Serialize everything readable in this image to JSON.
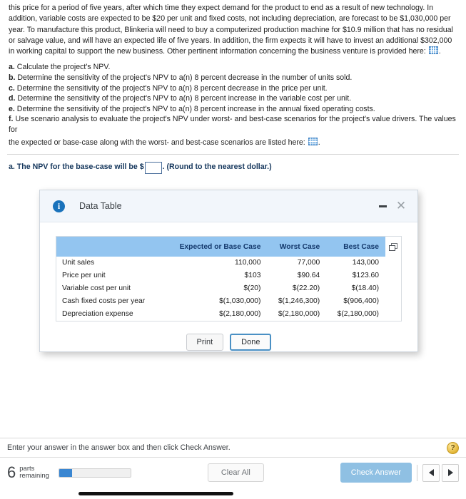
{
  "question": {
    "intro": "this price for a period of five years, after which time they expect demand for the product to end as a result of new technology.  In addition, variable costs are expected to be $20 per unit and fixed costs, not including depreciation, are forecast to be $1,030,000 per year.  To manufacture this product, Blinkeria will need to buy a computerized production machine for $10.9 million that has no residual or salvage value, and will have an expected life of five years.  In addition, the firm expects it will have to invest an additional $302,000 in working capital to support the new business.  Other pertinent information concerning the business venture is provided here:",
    "intro_icon": "grid-table-icon",
    "intro_trailing": ".",
    "parts": [
      {
        "letter": "a.",
        "text": "Calculate the project's NPV."
      },
      {
        "letter": "b.",
        "text": "Determine the sensitivity of the project's NPV to a(n) 8 percent decrease in the number of units sold."
      },
      {
        "letter": "c.",
        "text": "Determine the sensitivity of the project's NPV to a(n) 8 percent decrease in the price per unit."
      },
      {
        "letter": "d.",
        "text": "Determine the sensitivity of the project's NPV to a(n) 8 percent increase in the variable cost per unit."
      },
      {
        "letter": "e.",
        "text": "Determine the sensitivity of the project's NPV to a(n) 8 percent increase in the annual fixed operating costs."
      },
      {
        "letter": "f.",
        "text": "Use scenario analysis to evaluate the project's NPV under worst- and best-case scenarios for the project's value drivers.  The values for"
      }
    ],
    "part_f_tail": "the expected or base-case along with the worst- and best-case scenarios are listed here:",
    "part_f_icon": "grid-table-icon",
    "part_f_trailing": "."
  },
  "answer": {
    "letter": "a.",
    "prompt_before": "The NPV for the base-case will be $",
    "input_value": "",
    "prompt_after": ".  (Round to the nearest dollar.)"
  },
  "dialog": {
    "title": "Data Table",
    "info_icon": "info-circle-icon",
    "minimize_icon": "minimize-icon",
    "close_icon": "close-icon",
    "copy_icon": "copy-icon",
    "print_label": "Print",
    "done_label": "Done",
    "header_bg": "#f2f6fb",
    "table_header_bg": "#93c5f0"
  },
  "chart_data": {
    "type": "table",
    "title": "Data Table",
    "columns": [
      "",
      "Expected or Base Case",
      "Worst Case",
      "Best Case"
    ],
    "rows": [
      {
        "label": "Unit sales",
        "values": [
          "110,000",
          "77,000",
          "143,000"
        ]
      },
      {
        "label": "Price per unit",
        "values": [
          "$103",
          "$90.64",
          "$123.60"
        ]
      },
      {
        "label": "Variable cost per unit",
        "values": [
          "$(20)",
          "$(22.20)",
          "$(18.40)"
        ]
      },
      {
        "label": "Cash fixed costs per year",
        "values": [
          "$(1,030,000)",
          "$(1,246,300)",
          "$(906,400)"
        ]
      },
      {
        "label": "Depreciation expense",
        "values": [
          "$(2,180,000)",
          "$(2,180,000)",
          "$(2,180,000)"
        ]
      }
    ]
  },
  "status": {
    "message": "Enter your answer in the answer box and then click Check Answer.",
    "help_icon": "help-question-icon"
  },
  "toolbar": {
    "parts_count": "6",
    "parts_label_line1": "parts",
    "parts_label_line2": "remaining",
    "progress_percent": "18",
    "clear_all_label": "Clear All",
    "check_answer_label": "Check Answer",
    "prev_icon": "triangle-left-icon",
    "next_icon": "triangle-right-icon",
    "accent_color": "#3a86d1",
    "check_button_color": "#8fc0e3"
  }
}
